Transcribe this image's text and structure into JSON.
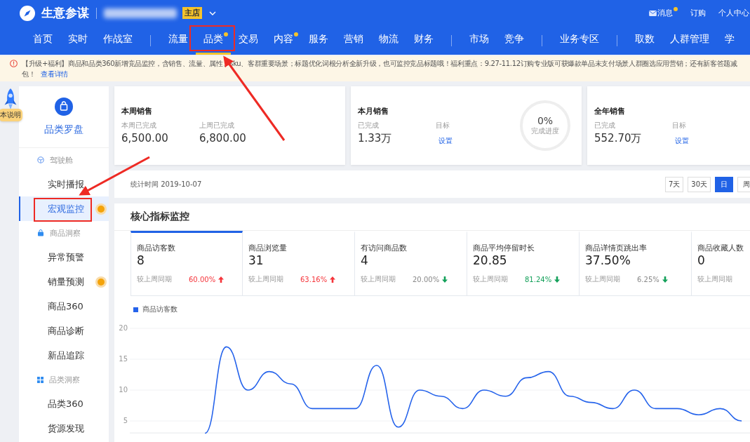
{
  "header": {
    "logo_text": "生意参谋",
    "shop_badge": "主店",
    "links": [
      {
        "label": "消息",
        "dot": true
      },
      {
        "label": "订购",
        "dot": false
      },
      {
        "label": "个人中心",
        "dot": false
      }
    ]
  },
  "nav": {
    "groups": [
      [
        {
          "label": "首页",
          "selected": false,
          "dot": false
        },
        {
          "label": "实时",
          "selected": false,
          "dot": false
        },
        {
          "label": "作战室",
          "selected": false,
          "dot": false
        }
      ],
      [
        {
          "label": "流量",
          "selected": false,
          "dot": false
        },
        {
          "label": "品类",
          "selected": true,
          "dot": true
        },
        {
          "label": "交易",
          "selected": false,
          "dot": false
        },
        {
          "label": "内容",
          "selected": false,
          "dot": true
        },
        {
          "label": "服务",
          "selected": false,
          "dot": false
        },
        {
          "label": "营销",
          "selected": false,
          "dot": false
        },
        {
          "label": "物流",
          "selected": false,
          "dot": false
        },
        {
          "label": "财务",
          "selected": false,
          "dot": false
        }
      ],
      [
        {
          "label": "市场",
          "selected": false,
          "dot": false
        },
        {
          "label": "竞争",
          "selected": false,
          "dot": false
        }
      ],
      [
        {
          "label": "业务专区",
          "selected": false,
          "dot": false
        }
      ],
      [
        {
          "label": "取数",
          "selected": false,
          "dot": false
        },
        {
          "label": "人群管理",
          "selected": false,
          "dot": false
        },
        {
          "label": "学",
          "selected": false,
          "dot": false
        }
      ]
    ]
  },
  "notice": {
    "lines": [
      "【升级+福利】商品和品类360新增竞品监控，含销售、流量、属性、sku、客群重要场景；标题优化词根分析全新升级，也可监控竞品标题哦！福利重点：9.27-11.12订购专业版可获爆款单品未支付场景人群圈选应用营销；还有新客答题减",
      "包！"
    ],
    "link": "查看详情"
  },
  "float_tag": "本说明",
  "sidebar": {
    "title": "品类罗盘",
    "sections": [
      {
        "title": "驾驶舱",
        "items": [
          {
            "label": "实时播报",
            "selected": false,
            "dot": false
          },
          {
            "label": "宏观监控",
            "selected": true,
            "dot": true
          }
        ]
      },
      {
        "title": "商品洞察",
        "items": [
          {
            "label": "异常预警",
            "selected": false,
            "dot": false
          },
          {
            "label": "销量预测",
            "selected": false,
            "dot": true
          },
          {
            "label": "商品360",
            "selected": false,
            "dot": false
          },
          {
            "label": "商品诊断",
            "selected": false,
            "dot": false
          },
          {
            "label": "新品追踪",
            "selected": false,
            "dot": false
          }
        ]
      },
      {
        "title": "品类洞察",
        "items": [
          {
            "label": "品类360",
            "selected": false,
            "dot": false
          },
          {
            "label": "货源发现",
            "selected": false,
            "dot": false
          }
        ]
      }
    ]
  },
  "sales_cards": [
    {
      "title": "本周销售",
      "stats": [
        {
          "kind": "value",
          "label": "本周已完成",
          "value": "6,500.00"
        },
        {
          "kind": "value",
          "label": "上周已完成",
          "value": "6,800.00"
        }
      ]
    },
    {
      "title": "本月销售",
      "stats": [
        {
          "kind": "value",
          "label": "已完成",
          "value": "1.33万"
        },
        {
          "kind": "link",
          "label": "目标",
          "value": "设置"
        }
      ],
      "progress": {
        "value": "0%",
        "label": "完成进度",
        "level": 0
      }
    },
    {
      "title": "全年销售",
      "stats": [
        {
          "kind": "value",
          "label": "已完成",
          "value": "552.70万"
        },
        {
          "kind": "link",
          "label": "目标",
          "value": "设置"
        }
      ]
    }
  ],
  "stats_bar": {
    "label": "统计时间 2019-10-07",
    "ranges": [
      {
        "label": "7天",
        "selected": false
      },
      {
        "label": "30天",
        "selected": false
      },
      {
        "label": "日",
        "selected": true
      },
      {
        "label": "周",
        "selected": false
      }
    ]
  },
  "core_metrics": {
    "title": "核心指标监控",
    "tiles": [
      {
        "name": "商品访客数",
        "value": "8",
        "compare": "较上周同期",
        "change": "60.00%",
        "rising": true,
        "significant": true,
        "selected": true
      },
      {
        "name": "商品浏览量",
        "value": "31",
        "compare": "较上周同期",
        "change": "63.16%",
        "rising": true,
        "significant": true,
        "selected": false
      },
      {
        "name": "有访问商品数",
        "value": "4",
        "compare": "较上周同期",
        "change": "20.00%",
        "rising": false,
        "significant": false,
        "selected": false
      },
      {
        "name": "商品平均停留时长",
        "value": "20.85",
        "compare": "较上周同期",
        "change": "81.24%",
        "rising": false,
        "significant": true,
        "selected": false
      },
      {
        "name": "商品详情页跳出率",
        "value": "37.50%",
        "compare": "较上周同期",
        "change": "6.25%",
        "rising": false,
        "significant": false,
        "selected": false
      },
      {
        "name": "商品收藏人数",
        "value": "0",
        "compare": "较上周同期",
        "selected": false
      }
    ],
    "chart_data": {
      "type": "line",
      "grid": true,
      "ylim": [
        3,
        20
      ],
      "yticks": [
        5,
        10,
        15,
        20
      ],
      "series": [
        {
          "name": "商品访客数",
          "color": "#2563eb",
          "values": [
            null,
            null,
            null,
            3,
            17,
            10,
            13,
            11,
            7,
            7,
            7,
            14,
            4,
            10,
            9,
            7,
            10,
            9,
            12,
            13,
            9,
            8,
            7,
            10,
            7,
            7,
            6,
            7,
            5
          ]
        }
      ]
    }
  }
}
